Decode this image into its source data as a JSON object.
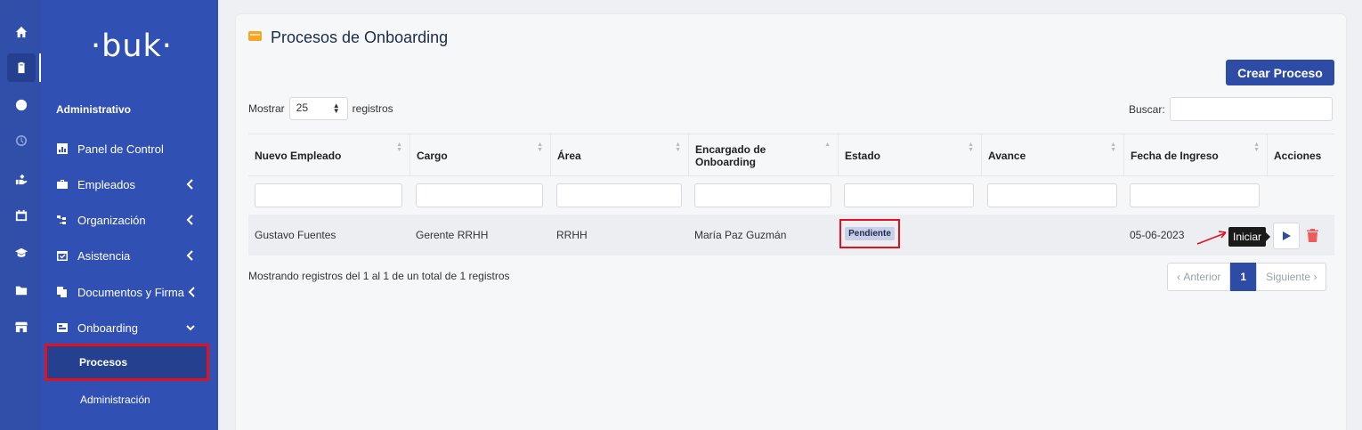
{
  "brand": {
    "logo": "·buk·"
  },
  "rail": {
    "icons": [
      "home-icon",
      "clipboard-icon",
      "dollar-icon",
      "clock-icon",
      "hand-icon",
      "calendar-icon",
      "graduation-icon",
      "folder-icon",
      "store-icon"
    ]
  },
  "sidebar": {
    "section": "Administrativo",
    "items": [
      {
        "label": "Panel de Control",
        "icon": "chart-icon"
      },
      {
        "label": "Empleados",
        "icon": "briefcase-icon"
      },
      {
        "label": "Organización",
        "icon": "org-icon"
      },
      {
        "label": "Asistencia",
        "icon": "calendar-check-icon"
      },
      {
        "label": "Documentos y Firma",
        "icon": "documents-icon"
      },
      {
        "label": "Onboarding",
        "icon": "onboarding-icon"
      }
    ],
    "subitems": [
      {
        "label": "Procesos",
        "active": true
      },
      {
        "label": "Administración",
        "active": false
      }
    ]
  },
  "page": {
    "title": "Procesos de Onboarding",
    "create_button": "Crear Proceso",
    "show_prefix": "Mostrar",
    "show_value": "25",
    "show_suffix": "registros",
    "search_label": "Buscar:"
  },
  "table": {
    "columns": [
      "Nuevo Empleado",
      "Cargo",
      "Área",
      "Encargado de Onboarding",
      "Estado",
      "Avance",
      "Fecha de Ingreso",
      "Acciones"
    ],
    "rows": [
      {
        "empleado": "Gustavo Fuentes",
        "cargo": "Gerente RRHH",
        "area": "RRHH",
        "encargado": "María Paz Guzmán",
        "estado": "Pendiente",
        "avance": "",
        "fecha": "05-06-2023"
      }
    ],
    "tooltip": "Iniciar"
  },
  "footer": {
    "info": "Mostrando registros del 1 al 1 de un total de 1 registros",
    "prev": "Anterior",
    "current_page": "1",
    "next": "Siguiente"
  },
  "colors": {
    "primary": "#2e4ba6",
    "sidebar": "#3050b4",
    "highlight": "#e3101f",
    "accent": "#f5a623"
  }
}
